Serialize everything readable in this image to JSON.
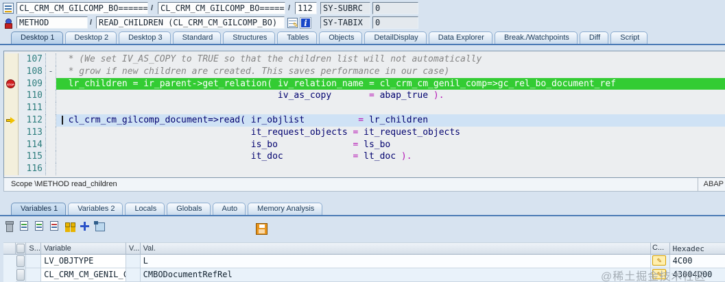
{
  "header": {
    "row1": {
      "icon": "program-icon",
      "field1": "CL_CRM_CM_GILCOMP_BO=========_",
      "sep1": "/",
      "field2": "CL_CRM_CM_GILCOMP_BO=========_",
      "sep2": "/",
      "line_field": "112",
      "sys_name": "SY-SUBRC",
      "sys_value": "0"
    },
    "row2": {
      "icon": "method-icon",
      "field1": "METHOD",
      "sep1": "/",
      "field2": "READ_CHILDREN (CL_CRM_CM_GILCOMP_BO)",
      "icons": [
        "change-display-icon",
        "info-icon"
      ],
      "sys_name": "SY-TABIX",
      "sys_value": "0"
    }
  },
  "desktop_tabs": [
    {
      "label": "Desktop 1",
      "active": true
    },
    {
      "label": "Desktop 2"
    },
    {
      "label": "Desktop 3"
    },
    {
      "label": "Standard"
    },
    {
      "label": "Structures"
    },
    {
      "label": "Tables"
    },
    {
      "label": "Objects"
    },
    {
      "label": "DetailDisplay"
    },
    {
      "label": "Data Explorer"
    },
    {
      "label": "Break./Watchpoints"
    },
    {
      "label": "Diff"
    },
    {
      "label": "Script"
    }
  ],
  "code": {
    "lines": [
      {
        "num": "107",
        "segments": [
          {
            "c": "comment",
            "t": "  * (We set IV_AS_COPY to TRUE so that the children list will not automatically"
          }
        ]
      },
      {
        "num": "108",
        "fold": "-",
        "segments": [
          {
            "c": "comment",
            "t": "  * grow if new children are created. This saves performance in our case)"
          }
        ]
      },
      {
        "num": "109",
        "marker": "breakpoint",
        "hl": "green",
        "segments": [
          {
            "c": "green",
            "t": "  lr_children = ir_parent->get_relation( iv_relation_name = cl_crm_cm_genil_comp=>gc_rel_bo_document_ref"
          }
        ]
      },
      {
        "num": "110",
        "segments": [
          {
            "c": "code",
            "t": "                                         iv_as_copy       "
          },
          {
            "c": "op",
            "t": "="
          },
          {
            "c": "code",
            "t": " abap_true "
          },
          {
            "c": "op",
            "t": ")."
          }
        ]
      },
      {
        "num": "111",
        "segments": []
      },
      {
        "num": "112",
        "marker": "arrow",
        "hl": "blue",
        "cursor": true,
        "segments": [
          {
            "c": "code",
            "t": "  cl_crm_cm_gilcomp_document=>read( ir_objlist          "
          },
          {
            "c": "op",
            "t": "="
          },
          {
            "c": "code",
            "t": " lr_children"
          }
        ]
      },
      {
        "num": "113",
        "segments": [
          {
            "c": "code",
            "t": "                                    it_request_objects "
          },
          {
            "c": "op",
            "t": "="
          },
          {
            "c": "code",
            "t": " it_request_objects"
          }
        ]
      },
      {
        "num": "114",
        "segments": [
          {
            "c": "code",
            "t": "                                    is_bo              "
          },
          {
            "c": "op",
            "t": "="
          },
          {
            "c": "code",
            "t": " ls_bo"
          }
        ]
      },
      {
        "num": "115",
        "segments": [
          {
            "c": "code",
            "t": "                                    it_doc             "
          },
          {
            "c": "op",
            "t": "="
          },
          {
            "c": "code",
            "t": " lt_doc "
          },
          {
            "c": "op",
            "t": ")."
          }
        ]
      },
      {
        "num": "116",
        "segments": []
      }
    ]
  },
  "scope_bar": {
    "text": "Scope \\METHOD read_children",
    "right_label": "ABAP"
  },
  "variable_tabs": [
    {
      "label": "Variables 1",
      "active": true
    },
    {
      "label": "Variables 2"
    },
    {
      "label": "Locals"
    },
    {
      "label": "Globals"
    },
    {
      "label": "Auto"
    },
    {
      "label": "Memory Analysis"
    }
  ],
  "toolbar": {
    "icons": [
      "trash-icon",
      "detail-list-icon",
      "detail-doc-icon",
      "remove-line-icon",
      "compare-icon",
      "move-icon",
      "services-icon"
    ],
    "save_icon": "save-icon"
  },
  "var_table": {
    "headers": {
      "sel": "",
      "s": "S...",
      "variable": "Variable",
      "v": "V...",
      "val": "Val.",
      "c": "C...",
      "hex": "Hexadec"
    },
    "rows": [
      {
        "s": "",
        "variable": "LV_OBJTYPE",
        "v": "",
        "val": "L",
        "c": "pencil-icon",
        "hex": "4C00"
      },
      {
        "s": "",
        "variable": "CL_CRM_CM_GENIL_COM...",
        "v": "",
        "val": "CMBODocumentRefRel",
        "c": "pencil-icon",
        "hex": "43004D00"
      }
    ]
  },
  "watermark": "@稀土掘金技术社区",
  "colors": {
    "breakpoint_line": "#33cc33",
    "current_line": "#cfe2f5",
    "breakpoint_red": "#d21f1f",
    "arrow_yellow": "#f2c200",
    "tab_underline": "#4a7ab5"
  }
}
